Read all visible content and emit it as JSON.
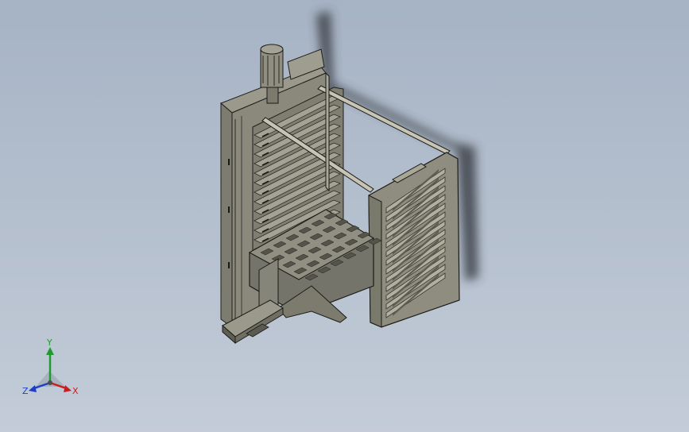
{
  "viewport": {
    "background_top": "#a6b3c4",
    "background_bottom": "#c3ccd8"
  },
  "model": {
    "part_color": "#8d8c7e",
    "edge_color": "#22221c",
    "shadow_color": "#30343a",
    "rod_color": "#bfbcae"
  },
  "triad": {
    "x_label": "X",
    "y_label": "Y",
    "z_label": "Z",
    "x_color": "#c81e1e",
    "y_color": "#1e9a2e",
    "z_color": "#1e3ec8"
  }
}
